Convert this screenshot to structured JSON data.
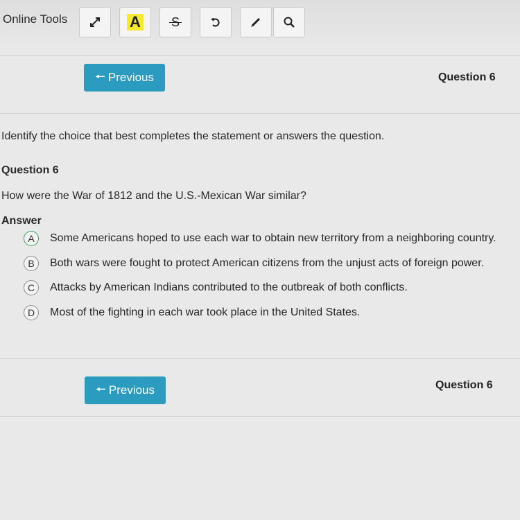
{
  "toolbar": {
    "title": "Online Tools",
    "tools": [
      {
        "name": "expand-icon"
      },
      {
        "name": "highlight-icon",
        "letter": "A",
        "highlight_color": "#f6ea30"
      },
      {
        "name": "strikethrough-icon",
        "letter": "S"
      },
      {
        "name": "undo-icon"
      },
      {
        "name": "pencil-icon"
      },
      {
        "name": "search-icon"
      }
    ]
  },
  "nav": {
    "previous_label": "Previous",
    "question_label": "Question 6",
    "accent_color": "#2b9bc0"
  },
  "question": {
    "instructions": "Identify the choice that best completes the statement or answers the question.",
    "heading": "Question 6",
    "text": "How were the War of 1812 and the U.S.-Mexican War similar?",
    "answer_label": "Answer",
    "choices": [
      {
        "letter": "A",
        "text": "Some Americans hoped to use each war to obtain new territory from a neighboring country."
      },
      {
        "letter": "B",
        "text": "Both wars were fought to protect American citizens from the unjust acts of foreign power."
      },
      {
        "letter": "C",
        "text": "Attacks by American Indians contributed to the outbreak of both conflicts."
      },
      {
        "letter": "D",
        "text": "Most of the fighting in each war took place in the United States."
      }
    ]
  }
}
